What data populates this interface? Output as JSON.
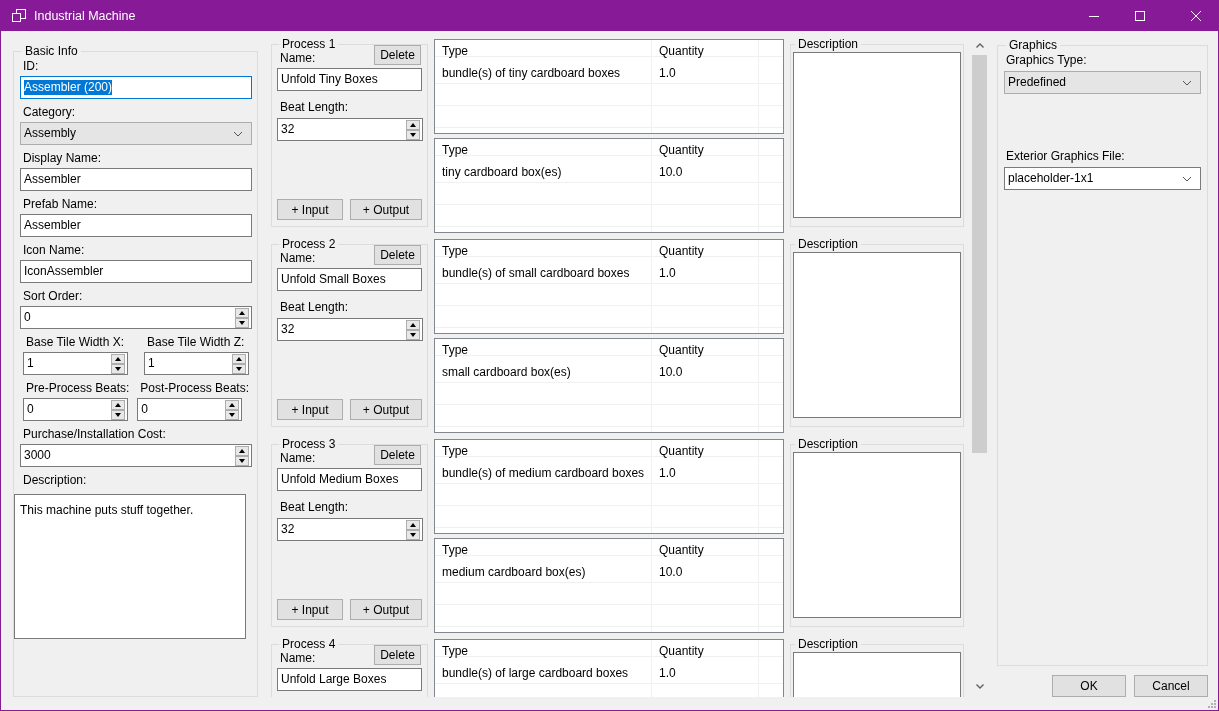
{
  "window": {
    "title": "Industrial Machine"
  },
  "basic_info": {
    "title": "Basic Info",
    "fields": [
      {
        "kind": "text",
        "label": "ID:",
        "value": "Assembler (200)",
        "focused": true
      },
      {
        "kind": "dropdown",
        "label": "Category:",
        "value": "Assembly",
        "focused": false
      },
      {
        "kind": "text",
        "label": "Display Name:",
        "value": "Assembler",
        "focused": false
      },
      {
        "kind": "text",
        "label": "Prefab Name:",
        "value": "Assembler",
        "focused": false
      },
      {
        "kind": "text",
        "label": "Icon Name:",
        "value": "IconAssembler",
        "focused": false
      },
      {
        "kind": "spinner",
        "label": "Sort Order:",
        "value": "0",
        "focused": false
      },
      {
        "kind": "spinner_pair",
        "items": [
          {
            "label": "Base Tile Width X:",
            "value": "1",
            "focused": false
          },
          {
            "label": "Base Tile Width Z:",
            "value": "1",
            "focused": false
          }
        ]
      },
      {
        "kind": "spinner_pair",
        "items": [
          {
            "label": "Pre-Process Beats:",
            "value": "0",
            "focused": false
          },
          {
            "label": "Post-Process Beats:",
            "value": "0",
            "focused": false
          }
        ]
      },
      {
        "kind": "spinner",
        "label": "Purchase/Installation Cost:",
        "value": "3000",
        "focused": false
      },
      {
        "kind": "textarea",
        "label": "Description:",
        "value": "This machine puts stuff together.",
        "focused": false
      }
    ]
  },
  "processes": [
    {
      "title": "Process 1",
      "name_label": "Name:",
      "name": "Unfold Tiny Boxes",
      "delete": "Delete",
      "beat_label": "Beat Length:",
      "beat": "32",
      "add_input": "+ Input",
      "add_output": "+ Output",
      "inputs": {
        "columns": [
          "Type",
          "Quantity"
        ],
        "rows": [
          [
            "bundle(s) of tiny cardboard boxes",
            "1.0"
          ]
        ]
      },
      "outputs": {
        "columns": [
          "Type",
          "Quantity"
        ],
        "rows": [
          [
            "tiny cardboard box(es)",
            "10.0"
          ]
        ]
      },
      "description_title": "Description"
    },
    {
      "title": "Process 2",
      "name_label": "Name:",
      "name": "Unfold Small Boxes",
      "delete": "Delete",
      "beat_label": "Beat Length:",
      "beat": "32",
      "add_input": "+ Input",
      "add_output": "+ Output",
      "inputs": {
        "columns": [
          "Type",
          "Quantity"
        ],
        "rows": [
          [
            "bundle(s) of small cardboard boxes",
            "1.0"
          ]
        ]
      },
      "outputs": {
        "columns": [
          "Type",
          "Quantity"
        ],
        "rows": [
          [
            "small cardboard box(es)",
            "10.0"
          ]
        ]
      },
      "description_title": "Description"
    },
    {
      "title": "Process 3",
      "name_label": "Name:",
      "name": "Unfold Medium Boxes",
      "delete": "Delete",
      "beat_label": "Beat Length:",
      "beat": "32",
      "add_input": "+ Input",
      "add_output": "+ Output",
      "inputs": {
        "columns": [
          "Type",
          "Quantity"
        ],
        "rows": [
          [
            "bundle(s) of medium cardboard boxes",
            "1.0"
          ]
        ]
      },
      "outputs": {
        "columns": [
          "Type",
          "Quantity"
        ],
        "rows": [
          [
            "medium cardboard box(es)",
            "10.0"
          ]
        ]
      },
      "description_title": "Description"
    },
    {
      "title": "Process 4",
      "name_label": "Name:",
      "name": "Unfold Large Boxes",
      "delete": "Delete",
      "inputs": {
        "columns": [
          "Type",
          "Quantity"
        ],
        "rows": [
          [
            "bundle(s) of large cardboard boxes",
            "1.0"
          ]
        ]
      },
      "description_title": "Description"
    }
  ],
  "graphics": {
    "title": "Graphics",
    "type_label": "Graphics Type:",
    "type_value": "Predefined",
    "file_label": "Exterior Graphics File:",
    "file_value": "placeholder-1x1"
  },
  "buttons": [
    "OK",
    "Cancel"
  ]
}
